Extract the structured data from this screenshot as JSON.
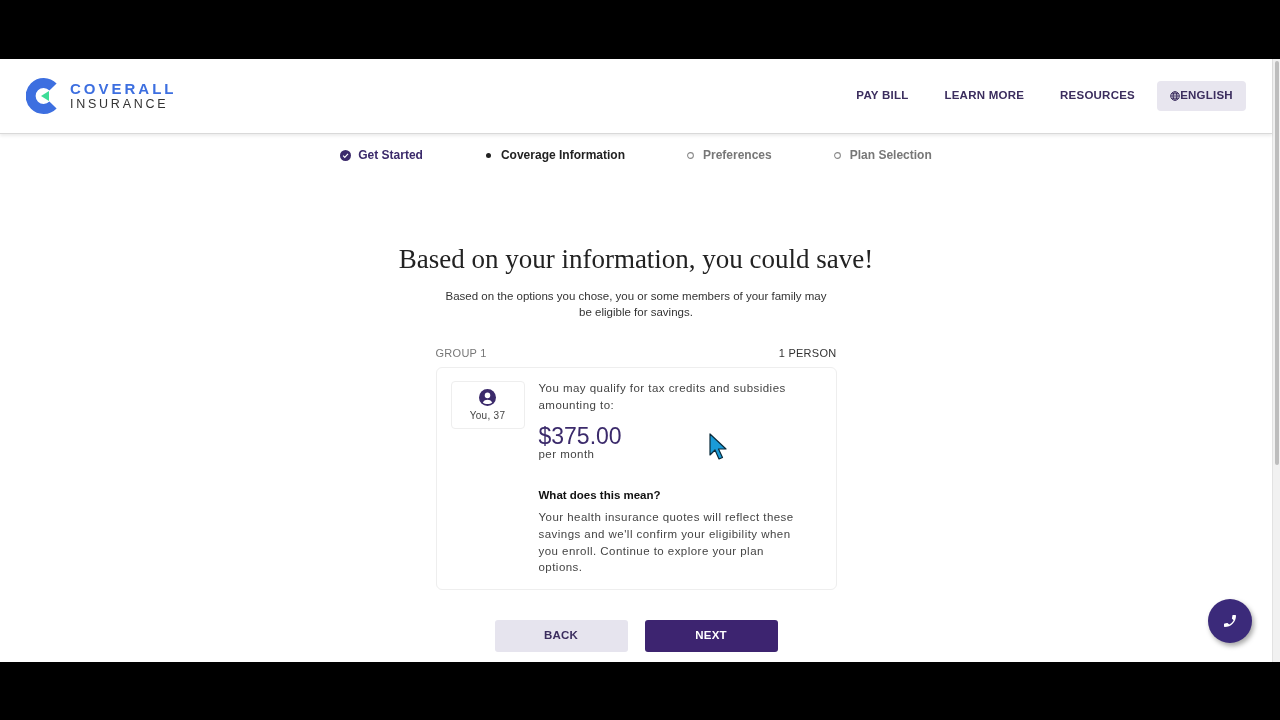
{
  "header": {
    "logo": {
      "line_1": "COVERALL",
      "line_2": "INSURANCE"
    },
    "nav": [
      {
        "label": "PAY BILL",
        "kind": "link"
      },
      {
        "label": "LEARN MORE",
        "kind": "link"
      },
      {
        "label": "RESOURCES",
        "kind": "link"
      },
      {
        "label": "ENGLISH",
        "kind": "language"
      }
    ]
  },
  "steps": [
    {
      "label": "Get Started",
      "kind": "done"
    },
    {
      "label": "Coverage Information",
      "kind": "current"
    },
    {
      "label": "Preferences",
      "kind": "upcoming"
    },
    {
      "label": "Plan Selection",
      "kind": "upcoming"
    }
  ],
  "heading": "Based on your information, you could save!",
  "intro": "Based on the options you chose, you or some members of your family may be eligible for savings.",
  "group": {
    "label": "GROUP 1",
    "count": "1 PERSON",
    "members": [
      {
        "label": "You, 37"
      }
    ],
    "qualify_text": "You may qualify for tax credits and subsidies amounting to:",
    "amount": "$375.00",
    "period": "per month",
    "explanation_title": "What does this mean?",
    "explanation": "Your health insurance quotes will reflect these savings and we'll confirm your eligibility when you enroll. Continue to explore your plan options."
  },
  "buttons": [
    {
      "label": "BACK",
      "kind": "secondary"
    },
    {
      "label": "NEXT",
      "kind": "primary"
    }
  ]
}
